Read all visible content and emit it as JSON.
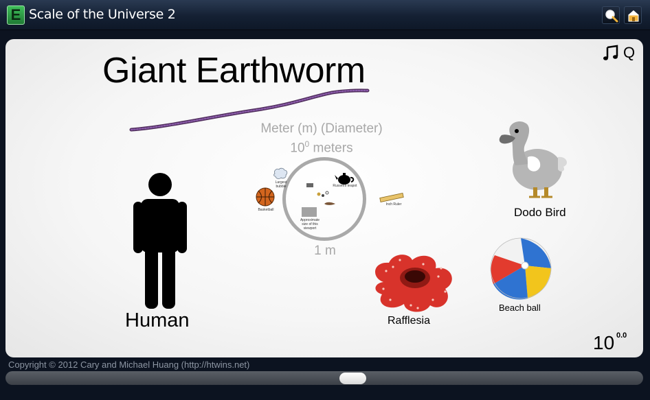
{
  "app": {
    "logo_letter": "E",
    "title": "Scale of the Universe 2"
  },
  "toolbar": {
    "search_icon": "magnifier-icon",
    "info_icon": "home-info-icon"
  },
  "panel": {
    "quality_label": "Q",
    "music_icon": "music-note-icon",
    "object_title": "Giant Earthworm",
    "meter_label": "Meter (m) (Diameter)",
    "meter_power_base": "10",
    "meter_power_exp": "0",
    "meter_power_unit": " meters",
    "scale_label": "1 m"
  },
  "mini_objects": {
    "basketball": "Basketball",
    "lungs": "Largest bubble",
    "teapot": "Russell's teapot",
    "ruler": "Inch Ruler",
    "fixture": "Approximate size of this viewport"
  },
  "objects": {
    "human": "Human",
    "dodo": "Dodo Bird",
    "beachball": "Beach ball",
    "rafflesia": "Rafflesia"
  },
  "exponent": {
    "base": "10",
    "value": "0.0"
  },
  "footer": {
    "copyright": "Copyright © 2012 Cary and Michael Huang (http://htwins.net)",
    "zoom_position": 0.545
  },
  "colors": {
    "accent": "#3fbf5a",
    "titlebar": "#142033",
    "worm": "#6b3b86"
  }
}
